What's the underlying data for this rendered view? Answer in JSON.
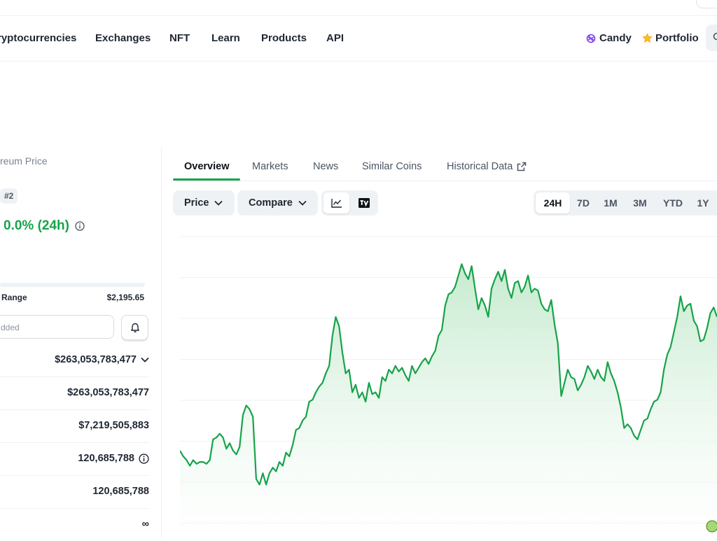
{
  "nav": {
    "items": [
      "ryptocurrencies",
      "Exchanges",
      "NFT",
      "Learn",
      "Products",
      "API"
    ],
    "candy": "Candy",
    "portfolio": "Portfolio"
  },
  "coin": {
    "name_partial": "reum Price",
    "rank": "#2",
    "change": "0.0% (24h)",
    "range_label": "Range",
    "range_high": "$2,195.65",
    "alert_placeholder": "dded"
  },
  "stats": [
    {
      "value": "$263,053,783,477",
      "extra": "chevron"
    },
    {
      "value": "$263,053,783,477"
    },
    {
      "value": "$7,219,505,883"
    },
    {
      "value": "120,685,788",
      "extra": "info"
    },
    {
      "value": "120,685,788"
    },
    {
      "value": "∞"
    }
  ],
  "tabs": [
    "Overview",
    "Markets",
    "News",
    "Similar Coins",
    "Historical Data"
  ],
  "controls": {
    "price": "Price",
    "compare": "Compare",
    "periods": [
      "24H",
      "7D",
      "1M",
      "3M",
      "YTD",
      "1Y"
    ],
    "active_period": "24H"
  },
  "colors": {
    "accent_green": "#16a34a",
    "line_green": "#16a34a",
    "fill_green": "#d9f2df",
    "gridline": "#eef0f3"
  },
  "chart_data": {
    "type": "area",
    "series": [
      {
        "values": [
          0.29,
          0.26,
          0.24,
          0.21,
          0.24,
          0.22,
          0.23,
          0.23,
          0.22,
          0.24,
          0.35,
          0.36,
          0.38,
          0.36,
          0.3,
          0.33,
          0.29,
          0.27,
          0.31,
          0.48,
          0.53,
          0.51,
          0.47,
          0.14,
          0.11,
          0.17,
          0.11,
          0.17,
          0.2,
          0.18,
          0.23,
          0.21,
          0.28,
          0.26,
          0.32,
          0.4,
          0.41,
          0.45,
          0.47,
          0.55,
          0.56,
          0.6,
          0.63,
          0.65,
          0.7,
          0.74,
          0.9,
          1.0,
          0.95,
          0.81,
          0.7,
          0.72,
          0.6,
          0.64,
          0.57,
          0.6,
          0.55,
          0.65,
          0.59,
          0.6,
          0.57,
          0.68,
          0.66,
          0.72,
          0.7,
          0.74,
          0.71,
          0.73,
          0.69,
          0.66,
          0.74,
          0.7,
          0.73,
          0.76,
          0.78,
          0.75,
          0.79,
          0.82,
          0.9,
          0.93,
          1.06,
          1.12,
          1.13,
          1.16,
          1.22,
          1.28,
          1.23,
          1.2,
          1.27,
          1.15,
          1.04,
          1.1,
          1.06,
          1.0,
          1.15,
          1.2,
          1.24,
          1.19,
          1.25,
          1.15,
          1.1,
          1.18,
          1.19,
          1.13,
          1.16,
          1.22,
          1.13,
          1.15,
          1.14,
          1.07,
          1.04,
          1.03,
          1.09,
          0.96,
          0.86,
          0.58,
          0.65,
          0.72,
          0.68,
          0.67,
          0.61,
          0.64,
          0.68,
          0.74,
          0.71,
          0.67,
          0.72,
          0.68,
          0.66,
          0.76,
          0.7,
          0.66,
          0.6,
          0.52,
          0.41,
          0.43,
          0.41,
          0.37,
          0.35,
          0.4,
          0.45,
          0.46,
          0.51,
          0.55,
          0.56,
          0.6,
          0.72,
          0.8,
          0.84,
          0.92,
          1.0,
          1.11,
          1.03,
          1.06,
          1.07,
          0.98,
          0.95,
          0.87,
          0.88,
          0.94,
          1.02,
          1.05,
          1.0
        ]
      }
    ],
    "grid": true,
    "legend": "none"
  }
}
